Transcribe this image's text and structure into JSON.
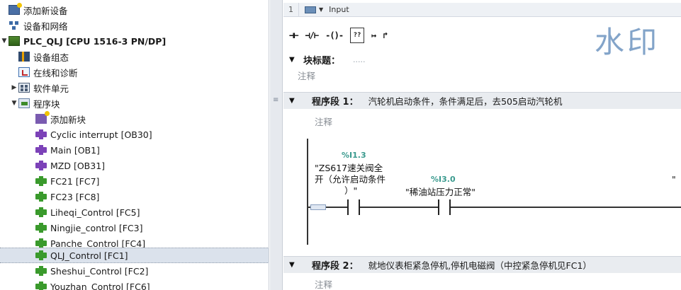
{
  "tree": {
    "items": [
      {
        "label": "添加新设备",
        "icon": "add-device-icon"
      },
      {
        "label": "设备和网络",
        "icon": "network-icon"
      },
      {
        "label": "PLC_QLJ [CPU 1516-3 PN/DP]",
        "icon": "plc-icon"
      },
      {
        "label": "设备组态",
        "icon": "device-config-icon"
      },
      {
        "label": "在线和诊断",
        "icon": "online-diagnostics-icon"
      },
      {
        "label": "软件单元",
        "icon": "software-units-icon"
      },
      {
        "label": "程序块",
        "icon": "program-blocks-icon"
      },
      {
        "label": "添加新块",
        "icon": "add-block-icon"
      },
      {
        "label": "Cyclic interrupt [OB30]",
        "icon": "ob-block-icon"
      },
      {
        "label": "Main [OB1]",
        "icon": "ob-block-icon"
      },
      {
        "label": "MZD [OB31]",
        "icon": "ob-block-icon"
      },
      {
        "label": "FC21 [FC7]",
        "icon": "fc-block-icon"
      },
      {
        "label": "FC23 [FC8]",
        "icon": "fc-block-icon"
      },
      {
        "label": "Liheqi_Control [FC5]",
        "icon": "fc-block-icon"
      },
      {
        "label": "Ningjie_control [FC3]",
        "icon": "fc-block-icon"
      },
      {
        "label": "Panche_Control [FC4]",
        "icon": "fc-block-icon"
      },
      {
        "label": "QLJ_Control [FC1]",
        "icon": "fc-block-icon"
      },
      {
        "label": "Sheshui_Control [FC2]",
        "icon": "fc-block-icon"
      },
      {
        "label": "Youzhan_Control [FC6]",
        "icon": "fc-block-icon"
      }
    ]
  },
  "editor": {
    "interface": {
      "row_number": "1",
      "label": "Input"
    },
    "toolbar": {
      "no_contact": "⊣⊢",
      "nc_contact": "⊣/⊢",
      "coil": "-()-",
      "empty_box": "??",
      "open_branch": "↦",
      "close_branch": "↱"
    },
    "watermark": "水印",
    "block_title": {
      "label": "块标题：",
      "dots": "....."
    },
    "block_comment": "注释",
    "networks": [
      {
        "label": "程序段 1：",
        "title": "汽轮机启动条件，条件满足后，去505启动汽轮机",
        "comment": "注释"
      },
      {
        "label": "程序段 2：",
        "title": "就地仪表柜紧急停机,停机电磁阀（中控紧急停机见FC1）",
        "comment": "注释"
      }
    ],
    "rung": {
      "contact1": {
        "address": "%I1.3",
        "name_line1": "\"ZS617速关阀全",
        "name_line2": "开（允许启动条件",
        "name_line3": "）\""
      },
      "contact2": {
        "address": "%I3.0",
        "name": "\"稀油站压力正常\""
      },
      "cut_tag": "\""
    }
  }
}
